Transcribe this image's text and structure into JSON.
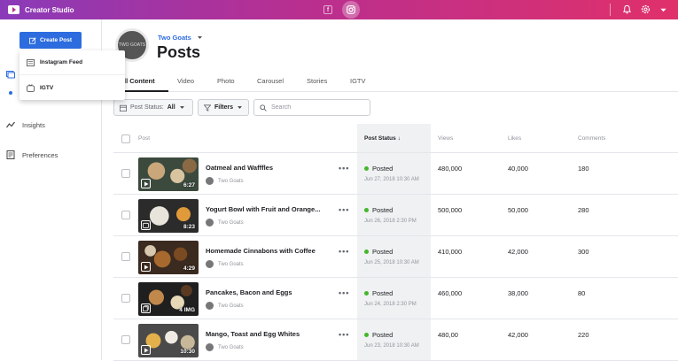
{
  "topbar": {
    "app_name": "Creator Studio",
    "facebook_label": "f",
    "colors": {
      "gradient_start": "#8a3ab9",
      "gradient_end": "#e0306a"
    }
  },
  "sidebar": {
    "create_post_label": "Create Post",
    "dropdown": [
      {
        "label": "Instagram Feed",
        "icon": "feed-icon"
      },
      {
        "label": "IGTV",
        "icon": "igtv-icon"
      }
    ],
    "items": [
      {
        "label": "Insights",
        "icon": "insights-icon"
      },
      {
        "label": "Preferences",
        "icon": "preferences-icon"
      }
    ]
  },
  "header": {
    "page_name": "Two Goats",
    "avatar_text": "TWO GOATS",
    "title": "Posts"
  },
  "tabs": [
    {
      "label": "ll Content",
      "active": true
    },
    {
      "label": "Video"
    },
    {
      "label": "Photo"
    },
    {
      "label": "Carousel"
    },
    {
      "label": "Stories"
    },
    {
      "label": "IGTV"
    }
  ],
  "filters": {
    "post_status_label": "Post Status:",
    "post_status_value": "All",
    "filters_label": "Filters",
    "search_placeholder": "Search"
  },
  "table": {
    "headers": {
      "post": "Post",
      "status": "Post Status",
      "views": "Views",
      "likes": "Likes",
      "comments": "Comments"
    },
    "rows": [
      {
        "title": "Oatmeal and Wafffles",
        "author": "Two Goats",
        "badge": "6:27",
        "type": "video",
        "status": "Posted",
        "date": "Jun 27, 2018 10:30 AM",
        "views": "480,000",
        "likes": "40,000",
        "comments": "180"
      },
      {
        "title": "Yogurt Bowl with Fruit and Orange...",
        "author": "Two Goats",
        "badge": "8:23",
        "type": "igtv",
        "status": "Posted",
        "date": "Jun 26, 2018 2:30 PM",
        "views": "500,000",
        "likes": "50,000",
        "comments": "280"
      },
      {
        "title": "Homemade Cinnabons with Coffee",
        "author": "Two Goats",
        "badge": "4:29",
        "type": "video",
        "status": "Posted",
        "date": "Jun 25, 2018 10:30 AM",
        "views": "410,000",
        "likes": "42,000",
        "comments": "300"
      },
      {
        "title": "Pancakes, Bacon and Eggs",
        "author": "Two Goats",
        "badge": "4 IMG",
        "type": "carousel",
        "status": "Posted",
        "date": "Jun 24, 2018 2:30 PM",
        "views": "460,000",
        "likes": "38,000",
        "comments": "80"
      },
      {
        "title": "Mango, Toast and Egg Whites",
        "author": "Two Goats",
        "badge": "10:30",
        "type": "video",
        "status": "Posted",
        "date": "Jun 23, 2018 10:30 AM",
        "views": "480,00",
        "likes": "42,000",
        "comments": "220"
      }
    ]
  }
}
